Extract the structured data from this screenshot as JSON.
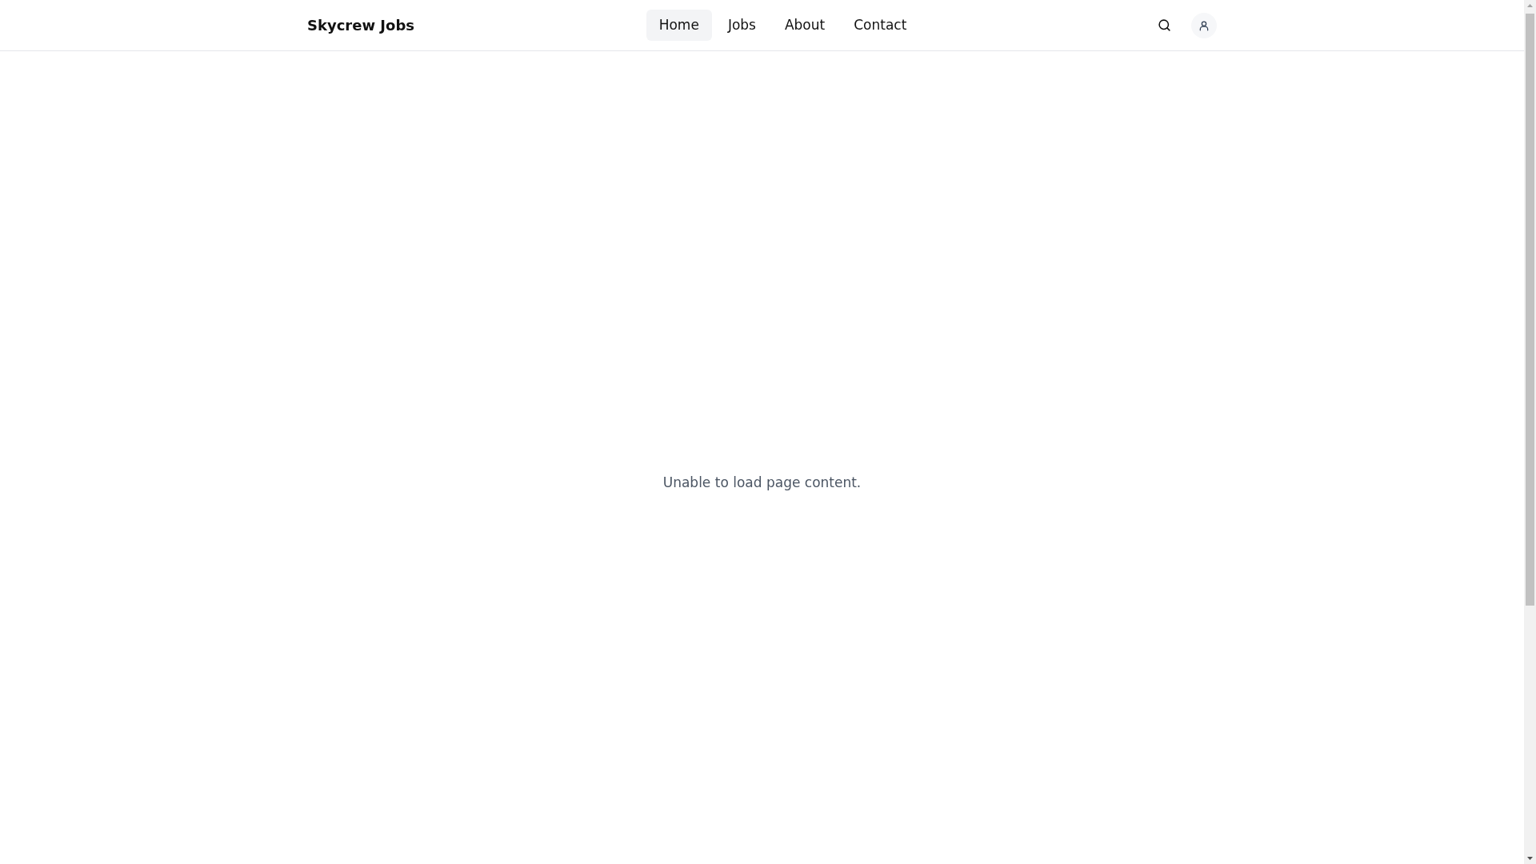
{
  "header": {
    "brand": "Skycrew Jobs",
    "nav": [
      {
        "label": "Home",
        "selected": true
      },
      {
        "label": "Jobs",
        "selected": false
      },
      {
        "label": "About",
        "selected": false
      },
      {
        "label": "Contact",
        "selected": false
      }
    ]
  },
  "main": {
    "message": "Unable to load page content."
  }
}
